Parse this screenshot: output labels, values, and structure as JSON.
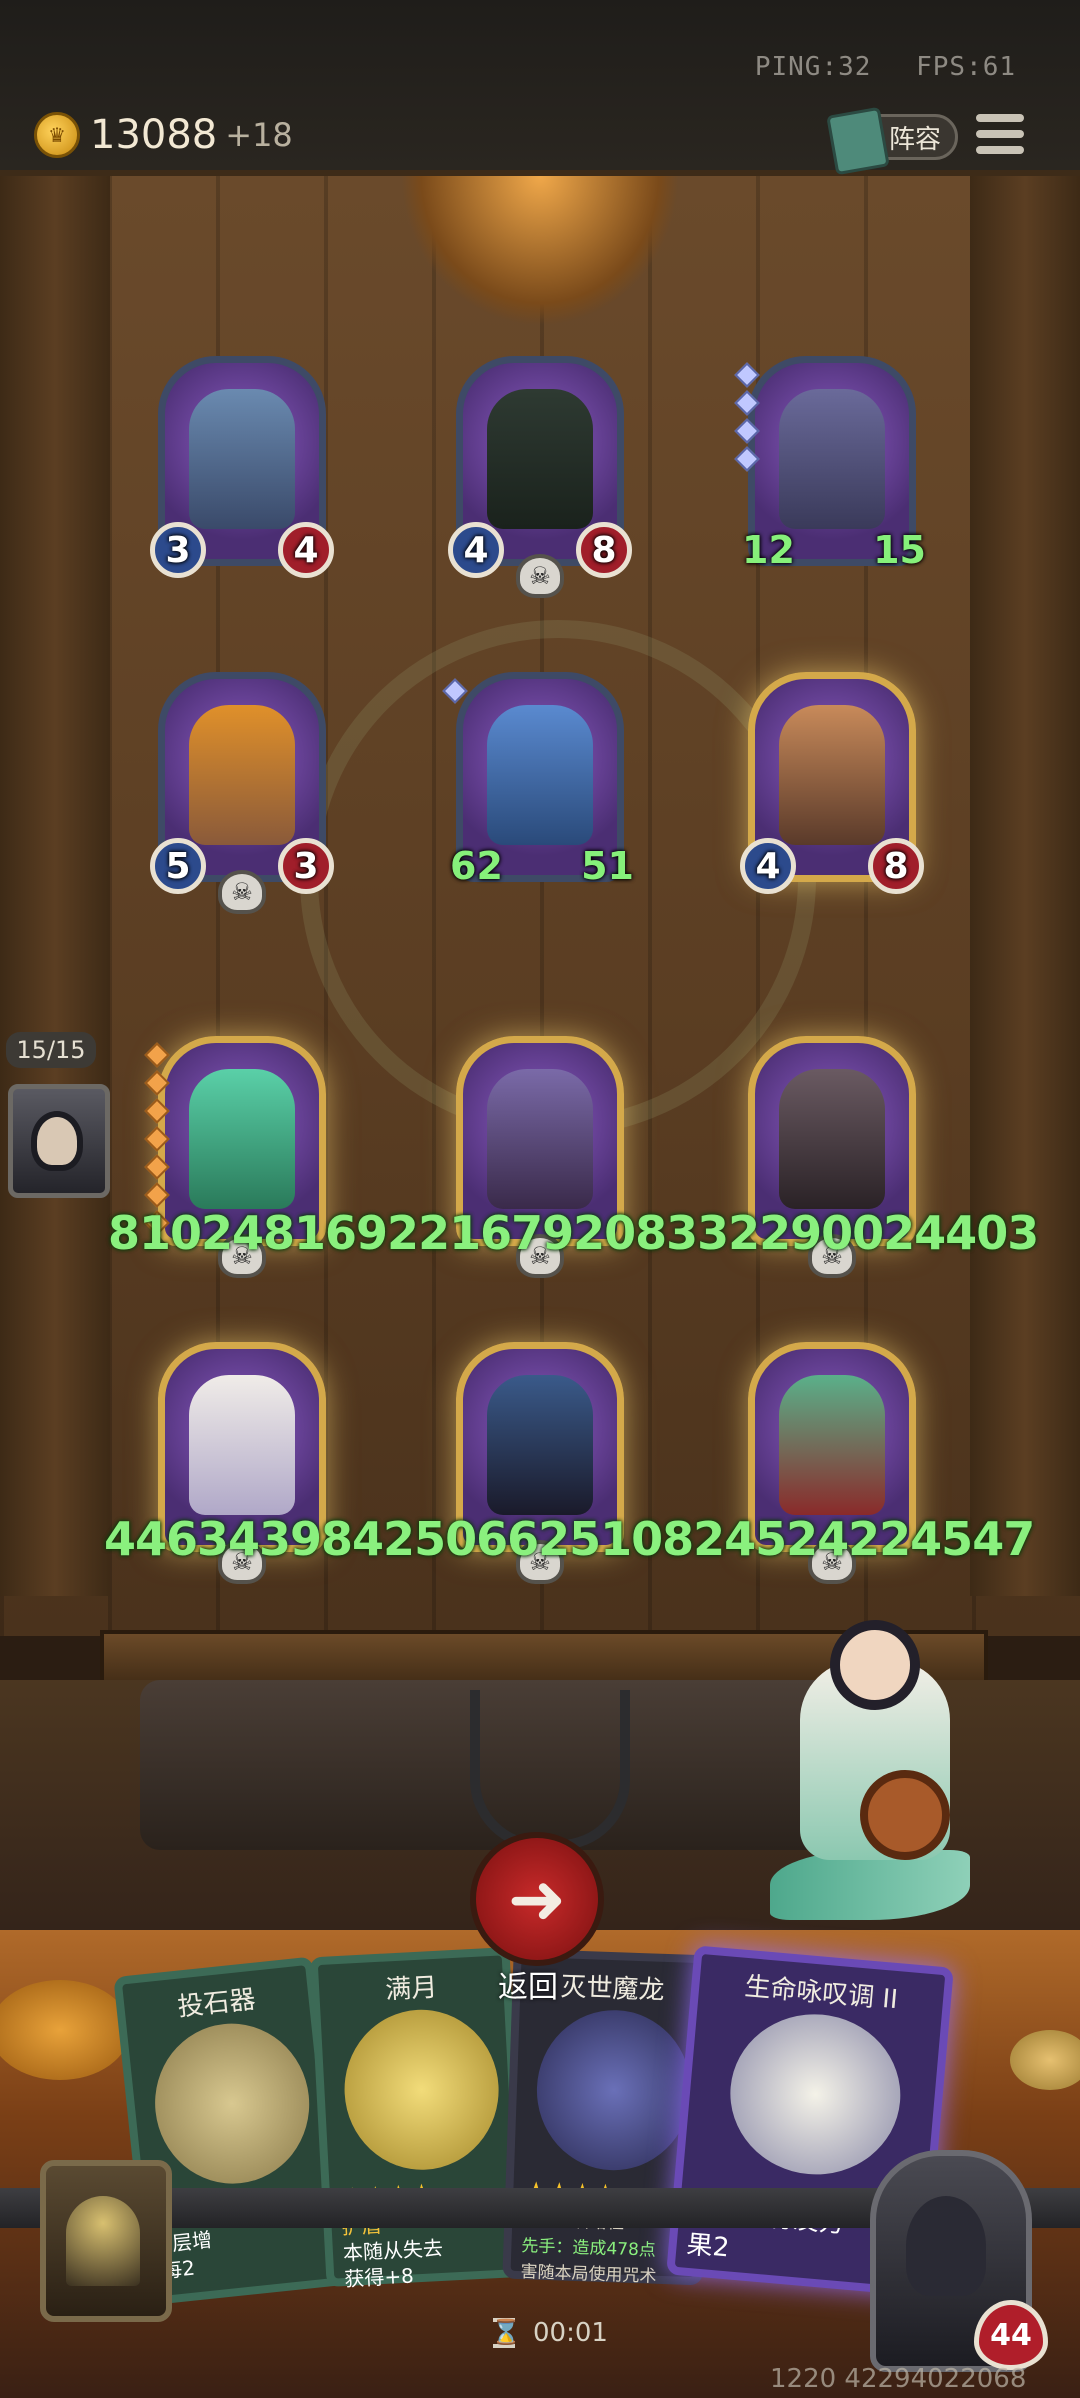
{
  "hud": {
    "ping": "PING:32",
    "fps": "FPS:61",
    "gold": "13088",
    "gold_income": "+18",
    "lineup_label": "阵容"
  },
  "board": {
    "row1": [
      {
        "name": "bat-demon",
        "attack": "3",
        "health": "4"
      },
      {
        "name": "coffin-cat",
        "attack": "4",
        "health": "8"
      },
      {
        "name": "octo-pirate",
        "attack": "12",
        "health": "15"
      }
    ],
    "row2": [
      {
        "name": "pelican",
        "attack": "5",
        "health": "3"
      },
      {
        "name": "blue-dragon",
        "attack": "62",
        "health": "51"
      },
      {
        "name": "fan-warrior",
        "attack": "4",
        "health": "8"
      }
    ],
    "row3_numbers": "810248169221679208332290024403",
    "row4_numbers": "446343984250662510824524224547"
  },
  "side": {
    "count": "15/15"
  },
  "back_button": {
    "label": "返回"
  },
  "hand": [
    {
      "title": "投石器",
      "stars": "★★★",
      "text_lines": [
        "2层增",
        "每2"
      ]
    },
    {
      "title": "满月",
      "stars": "★★★★",
      "text_lines": [
        "护盾",
        "本随从失去",
        "获得+8"
      ]
    },
    {
      "title": "灭世魔龙",
      "stars": "★★★★",
      "text_lines": [
        "可以附着给任",
        "先手：造成478点",
        "害随本局使用咒术"
      ]
    },
    {
      "title": "生命咏叹调 II",
      "stars": "",
      "text_lines": [
        "触发所有友方",
        "果2"
      ]
    }
  ],
  "footer": {
    "timer": "00:01",
    "hero_health": "44",
    "bottom_number": "1220 42294022068"
  }
}
